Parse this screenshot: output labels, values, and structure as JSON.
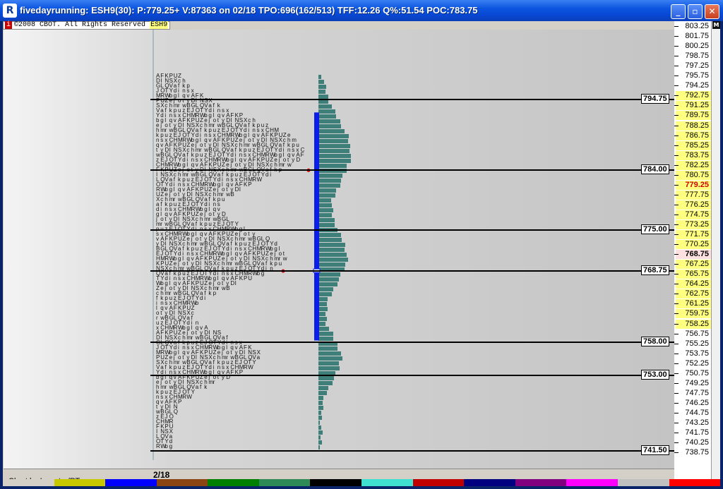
{
  "window": {
    "title": "fivedayrunning: ESH9(30): P:779.25+ V:87363 on 02/18 TPO:696(162/513) TFF:12.26 Q%:51.54 POC:783.75",
    "app_icon_glyph": "R",
    "buttons": {
      "minimize": "_",
      "maximize": "▫",
      "close": "✕"
    }
  },
  "header": {
    "info_badge": "i",
    "copyright": "©2008 CBOT. All Rights Reserved",
    "symbol": "ESH9"
  },
  "price_axis": {
    "labels": [
      "803.25",
      "801.75",
      "800.25",
      "798.75",
      "797.25",
      "795.75",
      "794.25",
      "792.75",
      "791.25",
      "789.75",
      "788.25",
      "786.75",
      "785.25",
      "783.75",
      "782.25",
      "780.75",
      "779.25",
      "777.75",
      "776.25",
      "774.75",
      "773.25",
      "771.75",
      "770.25",
      "768.75",
      "767.25",
      "765.75",
      "764.25",
      "762.75",
      "761.25",
      "759.75",
      "758.25",
      "756.75",
      "755.25",
      "753.75",
      "752.25",
      "750.75",
      "749.25",
      "747.75",
      "746.25",
      "744.75",
      "743.25",
      "741.75",
      "740.25",
      "738.75"
    ],
    "highlight_range": [
      "792.75",
      "758.25"
    ],
    "current_price": "779.25",
    "poc": "783.75",
    "ma_marker": "768.75"
  },
  "levels": [
    {
      "price": "794.75"
    },
    {
      "price": "784.00"
    },
    {
      "price": "775.00"
    },
    {
      "price": "768.75"
    },
    {
      "price": "758.00"
    },
    {
      "price": "753.00"
    },
    {
      "price": "741.50"
    }
  ],
  "tpo_letters": "ABCDEFGHIJKLMNOPQRSTUVWXYZabcdefghijklmnopqrstuvwxyz",
  "date_label": "2/18",
  "status": {
    "text": "Chart by Investor/RT"
  },
  "colors": {
    "histogram": "#3e7f7a",
    "value_area_bar": "#0a1ee8",
    "title_bar": "#0c55e0",
    "highlight": "#ffff80",
    "current_price": "#d00000"
  },
  "palette": [
    "#d4d0c8",
    "#c8c800",
    "#0000ff",
    "#8b4513",
    "#008000",
    "#2e8b57",
    "#000000",
    "#40e0d0",
    "#c00000",
    "#000080",
    "#800080",
    "#ff00ff",
    "#c0c0c0",
    "#ff0000"
  ]
}
